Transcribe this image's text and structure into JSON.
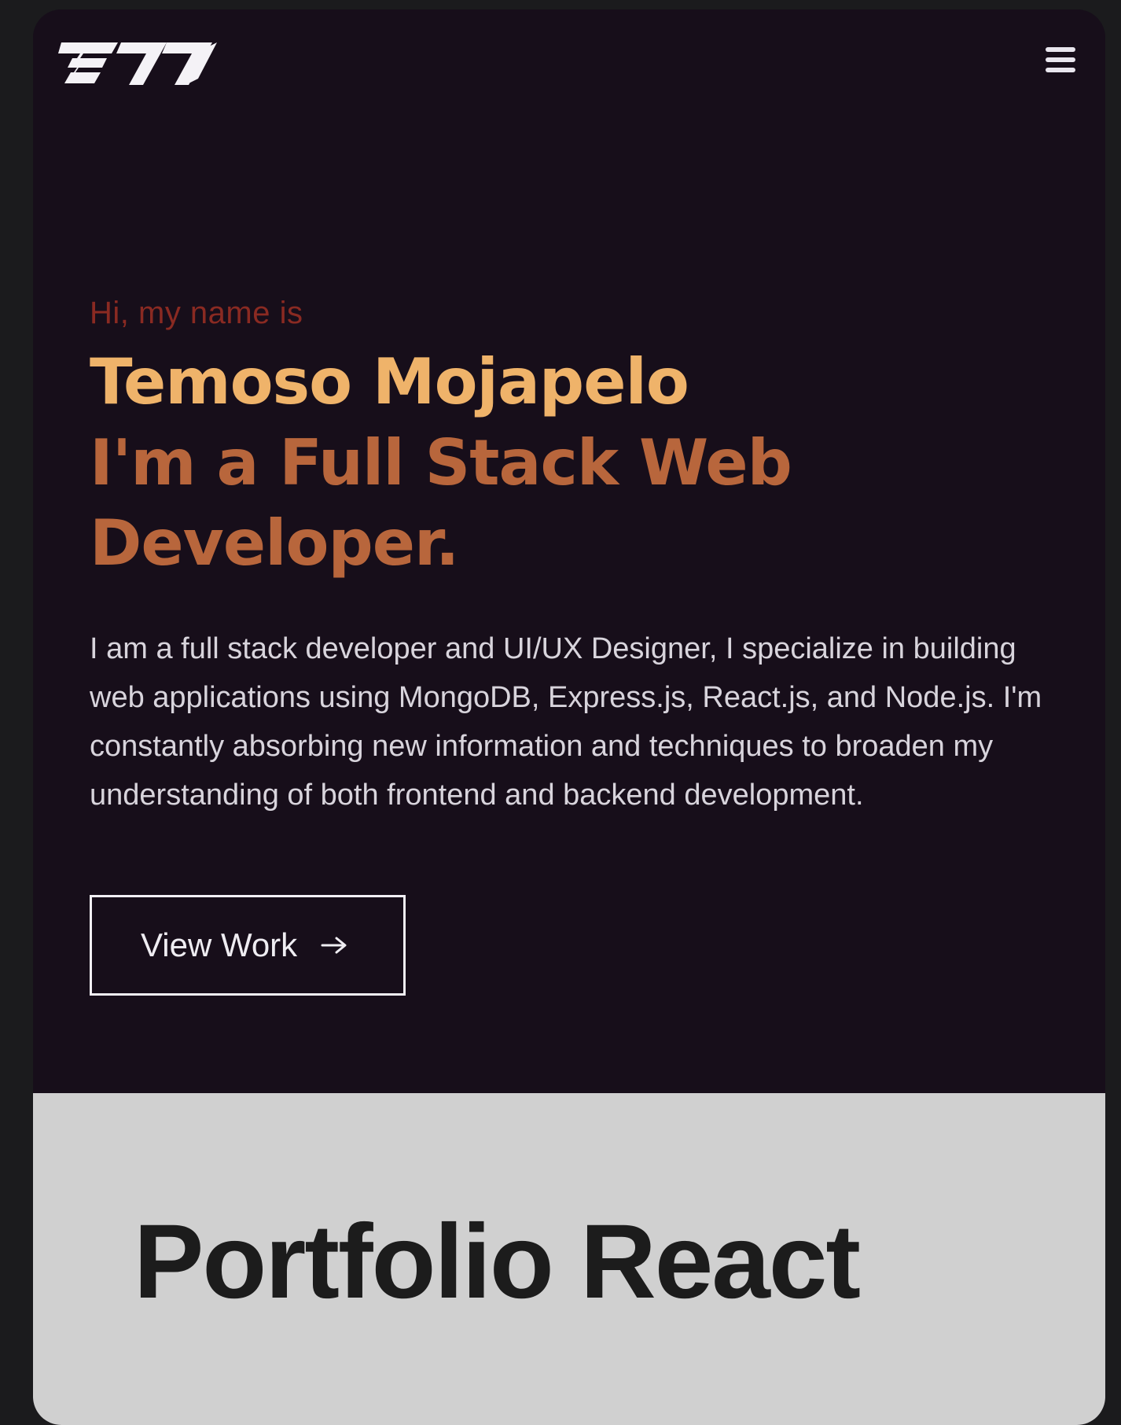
{
  "header": {
    "logo_label": "TMJ logo",
    "menu_icon": "hamburger-menu-icon"
  },
  "hero": {
    "greeting": "Hi, my name is",
    "name": "Temoso Mojapelo",
    "role": "I'm a Full Stack Web Developer.",
    "bio": "I am a full stack developer and UI/UX Designer, I specialize in building web applications using MongoDB, Express.js, React.js, and Node.js. I'm constantly absorbing new information and techniques to broaden my understanding of both frontend and backend development.",
    "cta_label": "View Work",
    "cta_icon": "arrow-right-icon"
  },
  "portfolio": {
    "title": "Portfolio React"
  },
  "colors": {
    "background": "#170e1a",
    "greeting": "#8a2a22",
    "name": "#efb36a",
    "role": "#b8663c",
    "bio": "#d8d4dc",
    "portfolio_bg": "#d0d0d0",
    "portfolio_text": "#1c1c1c"
  }
}
